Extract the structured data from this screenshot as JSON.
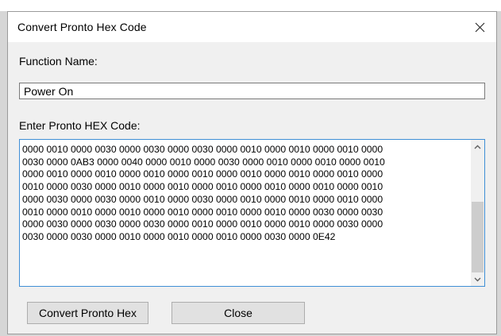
{
  "dialog": {
    "title": "Convert Pronto Hex Code",
    "close_icon": "close-icon"
  },
  "function_name": {
    "label": "Function Name:",
    "value": "Power On"
  },
  "pronto_hex": {
    "label": "Enter Pronto HEX Code:",
    "value": "0000 0010 0000 0030 0000 0030 0000 0030 0000 0010 0000 0010 0000 0010 0000\n0030 0000 0AB3 0000 0040 0000 0010 0000 0030 0000 0010 0000 0010 0000 0010\n0000 0010 0000 0010 0000 0010 0000 0010 0000 0010 0000 0010 0000 0010 0000\n0010 0000 0030 0000 0010 0000 0010 0000 0010 0000 0010 0000 0010 0000 0010\n0000 0030 0000 0030 0000 0010 0000 0030 0000 0010 0000 0010 0000 0010 0000\n0010 0000 0010 0000 0010 0000 0010 0000 0010 0000 0010 0000 0030 0000 0030\n0000 0030 0000 0030 0000 0030 0000 0010 0000 0010 0000 0010 0000 0030 0000\n0030 0000 0030 0000 0010 0000 0010 0000 0010 0000 0030 0000 0E42"
  },
  "buttons": {
    "convert_label": "Convert Pronto Hex",
    "close_label": "Close"
  },
  "colors": {
    "dialog_bg": "#f0f0f0",
    "title_bg": "#ffffff",
    "focus_border": "#3f8fd6",
    "button_bg": "#e1e1e1"
  }
}
